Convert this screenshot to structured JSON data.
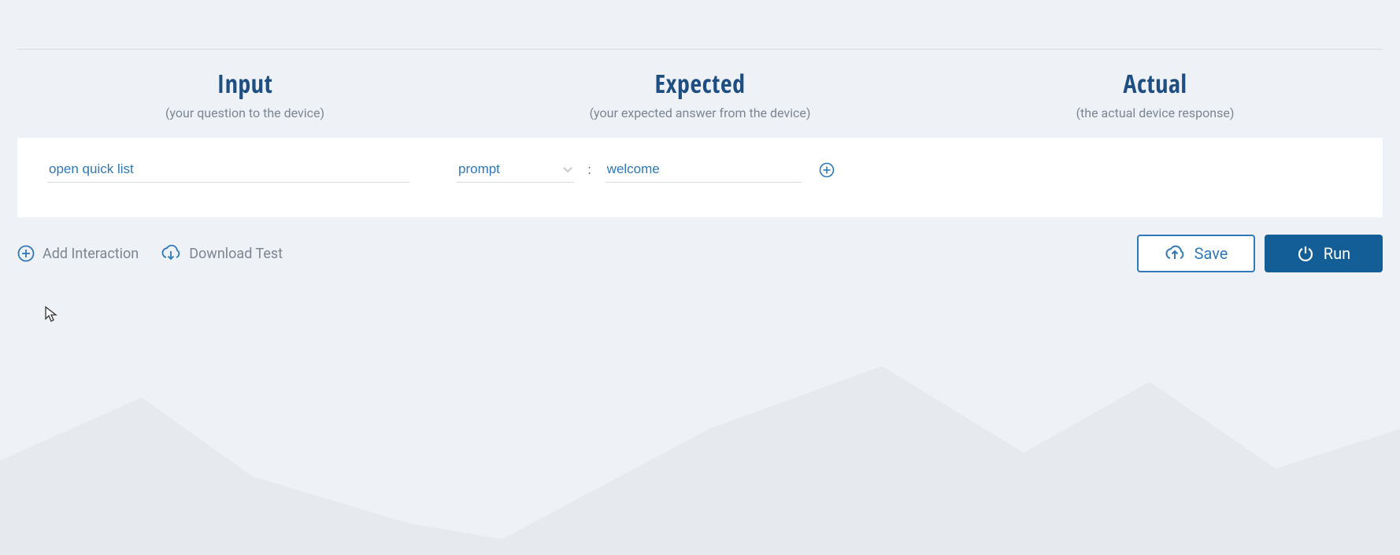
{
  "headers": {
    "input": {
      "title": "Input",
      "sub": "(your question to the device)"
    },
    "expected": {
      "title": "Expected",
      "sub": "(your expected answer from the device)"
    },
    "actual": {
      "title": "Actual",
      "sub": "(the actual device response)"
    }
  },
  "row": {
    "input_value": "open quick list",
    "expected_type": "prompt",
    "expected_separator": ":",
    "expected_value": "welcome"
  },
  "actions": {
    "add_interaction": "Add Interaction",
    "download_test": "Download Test",
    "save": "Save",
    "run": "Run"
  },
  "colors": {
    "accent": "#2f78b9",
    "primary_button": "#135e96",
    "text_muted": "#7c8591",
    "heading": "#1f4f82"
  }
}
